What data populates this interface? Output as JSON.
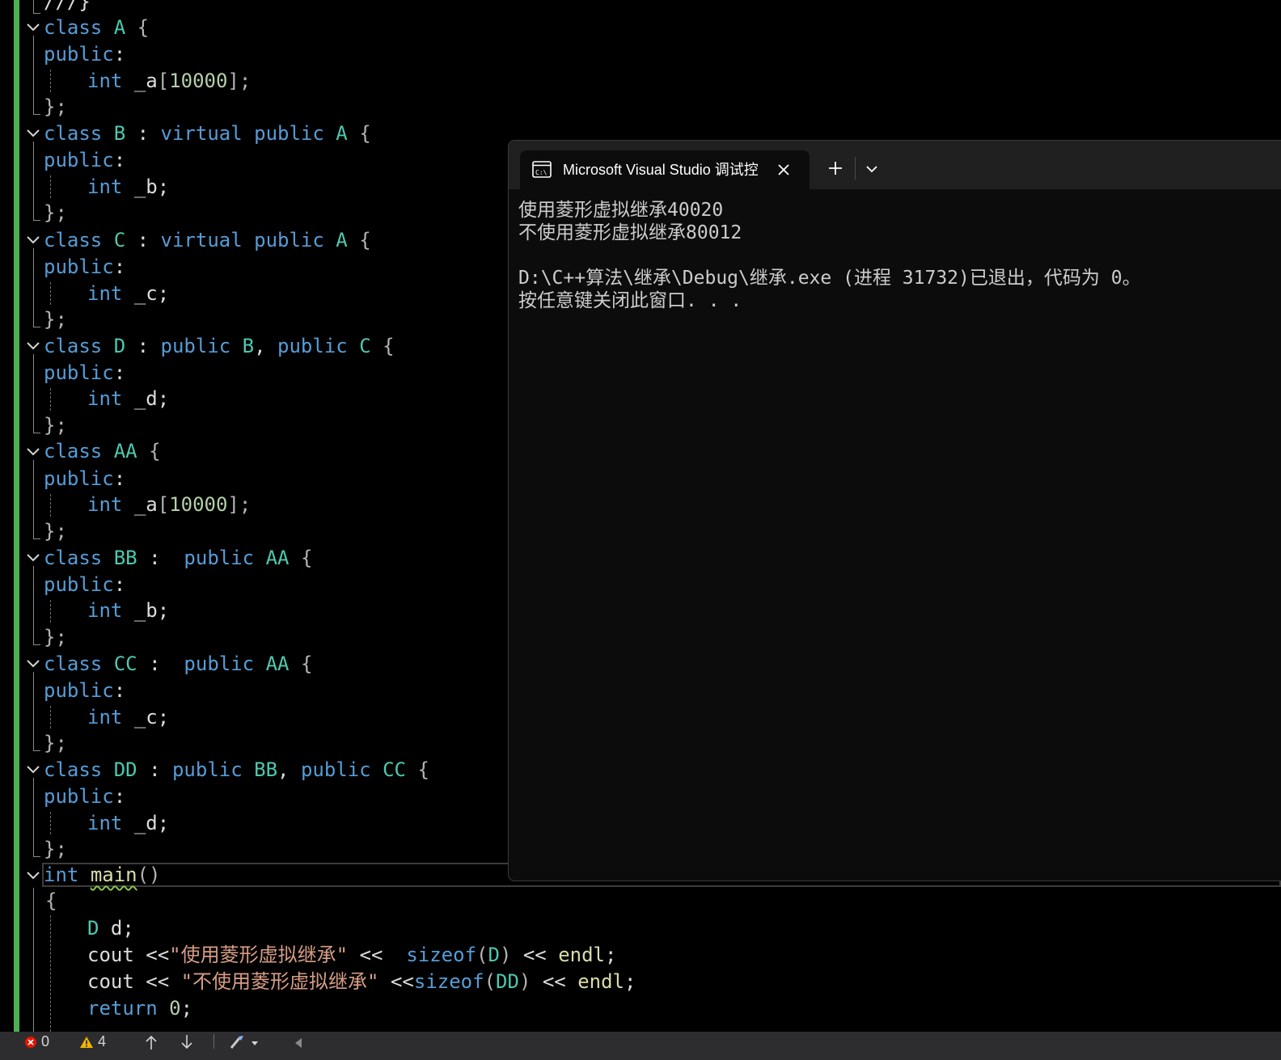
{
  "editor": {
    "lines": {
      "l0": {
        "text": "///}"
      },
      "l1": {
        "kw1": "class",
        "name": "A",
        "brace": "{"
      },
      "l2": {
        "kw": "public",
        "punct": ":"
      },
      "l3": {
        "kw": "int",
        "ident": "_a",
        "lb": "[",
        "num": "10000",
        "rb": "];"
      },
      "l4": {
        "text": "};"
      },
      "l5": {
        "kw1": "class",
        "name": "B",
        "colon": ":",
        "kw2": "virtual",
        "kw3": "public",
        "base": "A",
        "brace": "{"
      },
      "l6": {
        "kw": "public",
        "punct": ":"
      },
      "l7": {
        "kw": "int",
        "ident": "_b;"
      },
      "l8": {
        "text": "};"
      },
      "l9": {
        "kw1": "class",
        "name": "C",
        "colon": ":",
        "kw2": "virtual",
        "kw3": "public",
        "base": "A",
        "brace": "{"
      },
      "l10": {
        "kw": "public",
        "punct": ":"
      },
      "l11": {
        "kw": "int",
        "ident": "_c;"
      },
      "l12": {
        "text": "};"
      },
      "l13": {
        "kw1": "class",
        "name": "D",
        "colon": ":",
        "kw2": "public",
        "base1": "B",
        "comma": ",",
        "kw3": "public",
        "base2": "C",
        "brace": "{"
      },
      "l14": {
        "kw": "public",
        "punct": ":"
      },
      "l15": {
        "kw": "int",
        "ident": "_d;"
      },
      "l16": {
        "text": "};"
      },
      "l17": {
        "kw1": "class",
        "name": "AA",
        "brace": "{"
      },
      "l18": {
        "kw": "public",
        "punct": ":"
      },
      "l19": {
        "kw": "int",
        "ident": "_a",
        "lb": "[",
        "num": "10000",
        "rb": "];"
      },
      "l20": {
        "text": "};"
      },
      "l21": {
        "kw1": "class",
        "name": "BB",
        "colon": ":",
        "kw2": "public",
        "base": "AA",
        "brace": "{"
      },
      "l22": {
        "kw": "public",
        "punct": ":"
      },
      "l23": {
        "kw": "int",
        "ident": "_b;"
      },
      "l24": {
        "text": "};"
      },
      "l25": {
        "kw1": "class",
        "name": "CC",
        "colon": ":",
        "kw2": "public",
        "base": "AA",
        "brace": "{"
      },
      "l26": {
        "kw": "public",
        "punct": ":"
      },
      "l27": {
        "kw": "int",
        "ident": "_c;"
      },
      "l28": {
        "text": "};"
      },
      "l29": {
        "kw1": "class",
        "name": "DD",
        "colon": ":",
        "kw2": "public",
        "base1": "BB",
        "comma": ",",
        "kw3": "public",
        "base2": "CC",
        "brace": "{"
      },
      "l30": {
        "kw": "public",
        "punct": ":"
      },
      "l31": {
        "kw": "int",
        "ident": "_d;"
      },
      "l32": {
        "text": "};"
      },
      "l33": {
        "kw": "int",
        "fn": "main",
        "paren": "()"
      },
      "l34": {
        "text": "{"
      },
      "l35": {
        "type": "D",
        "ident": "d;"
      },
      "l36": {
        "ident": "cout",
        "op": "<<",
        "str": "\"使用菱形虚拟继承\"",
        "op2": "<<",
        "kw": "sizeof",
        "lp": "(",
        "arg": "D",
        "rp": ")",
        "op3": "<<",
        "end": "endl",
        "semi": ";"
      },
      "l37": {
        "ident": "cout",
        "op": "<<",
        "str": "\"不使用菱形虚拟继承\"",
        "op2": "<<",
        "kw": "sizeof",
        "lp": "(",
        "arg": "DD",
        "rp": ")",
        "op3": "<<",
        "end": "endl",
        "semi": ";"
      },
      "l38": {
        "kw": "return",
        "num": "0",
        "semi": ";"
      }
    }
  },
  "console": {
    "tab_title": "Microsoft Visual Studio 调试控",
    "output": [
      "使用菱形虚拟继承40020",
      "不使用菱形虚拟继承80012",
      "",
      "D:\\C++算法\\继承\\Debug\\继承.exe (进程 31732)已退出，代码为 0。",
      "按任意键关闭此窗口. . ."
    ]
  },
  "status_bar": {
    "errors": "0",
    "warnings": "4"
  },
  "colors": {
    "keyword": "#569cd6",
    "type": "#4ec9b0",
    "function": "#dcdcaa",
    "number": "#b5cea8",
    "string": "#d69d85",
    "change_bar": "#4caf50",
    "console_bg": "#0c0c0c",
    "status_bar_bg": "#2d2d30"
  },
  "icons": [
    "fold-chevron-icon",
    "console-app-icon",
    "close-icon",
    "plus-icon",
    "chevron-down-icon",
    "error-icon",
    "warning-icon",
    "arrow-up-icon",
    "arrow-down-icon",
    "brush-icon",
    "triangle-left-icon"
  ]
}
